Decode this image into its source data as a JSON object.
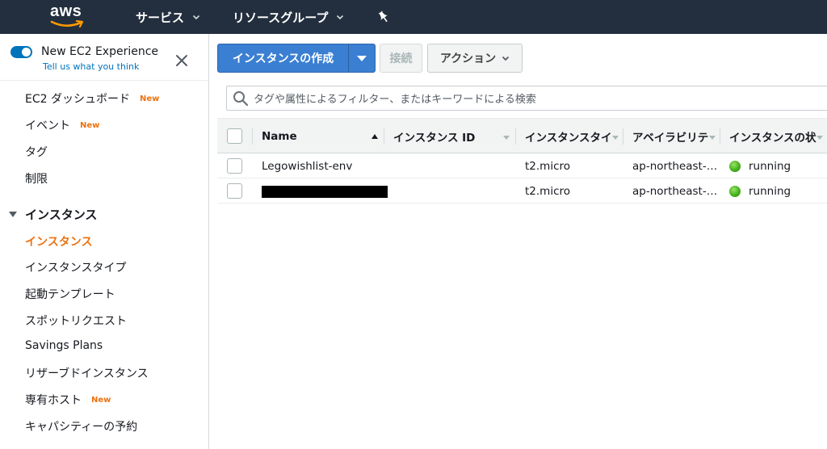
{
  "topnav": {
    "logo": "aws",
    "services_label": "サービス",
    "resource_groups_label": "リソースグループ"
  },
  "sidebar": {
    "experience_title": "New EC2 Experience",
    "experience_link": "Tell us what you think",
    "new_badge": "New",
    "items": [
      {
        "label": "EC2 ダッシュボード",
        "new": true
      },
      {
        "label": "イベント",
        "new": true
      },
      {
        "label": "タグ",
        "new": false
      },
      {
        "label": "制限",
        "new": false
      }
    ],
    "section_title": "インスタンス",
    "section_items": [
      {
        "label": "インスタンス",
        "active": true,
        "new": false
      },
      {
        "label": "インスタンスタイプ",
        "active": false,
        "new": false
      },
      {
        "label": "起動テンプレート",
        "active": false,
        "new": false
      },
      {
        "label": "スポットリクエスト",
        "active": false,
        "new": false
      },
      {
        "label": "Savings Plans",
        "active": false,
        "new": false
      },
      {
        "label": "リザーブドインスタンス",
        "active": false,
        "new": false
      },
      {
        "label": "専有ホスト",
        "active": false,
        "new": true
      },
      {
        "label": "キャパシティーの予約",
        "active": false,
        "new": false
      }
    ]
  },
  "toolbar": {
    "launch_label": "インスタンスの作成",
    "connect_label": "接続",
    "actions_label": "アクション"
  },
  "filter": {
    "placeholder": "タグや属性によるフィルター、またはキーワードによる検索"
  },
  "table": {
    "columns": [
      "Name",
      "インスタンス ID",
      "インスタンスタイ",
      "アベイラビリテ",
      "インスタンスの状"
    ],
    "rows": [
      {
        "name": "Legowishlist-env",
        "redacted_name": false,
        "instance_id": "",
        "type": "t2.micro",
        "az": "ap-northeast-…",
        "state": "running"
      },
      {
        "name": "",
        "redacted_name": true,
        "instance_id": "",
        "type": "t2.micro",
        "az": "ap-northeast-…",
        "state": "running"
      }
    ]
  },
  "colors": {
    "nav_bg": "#232f3e",
    "primary_button": "#3b7fd2",
    "accent_orange": "#ec7211",
    "link_blue": "#0073bb",
    "running_green": "#45b01b"
  }
}
